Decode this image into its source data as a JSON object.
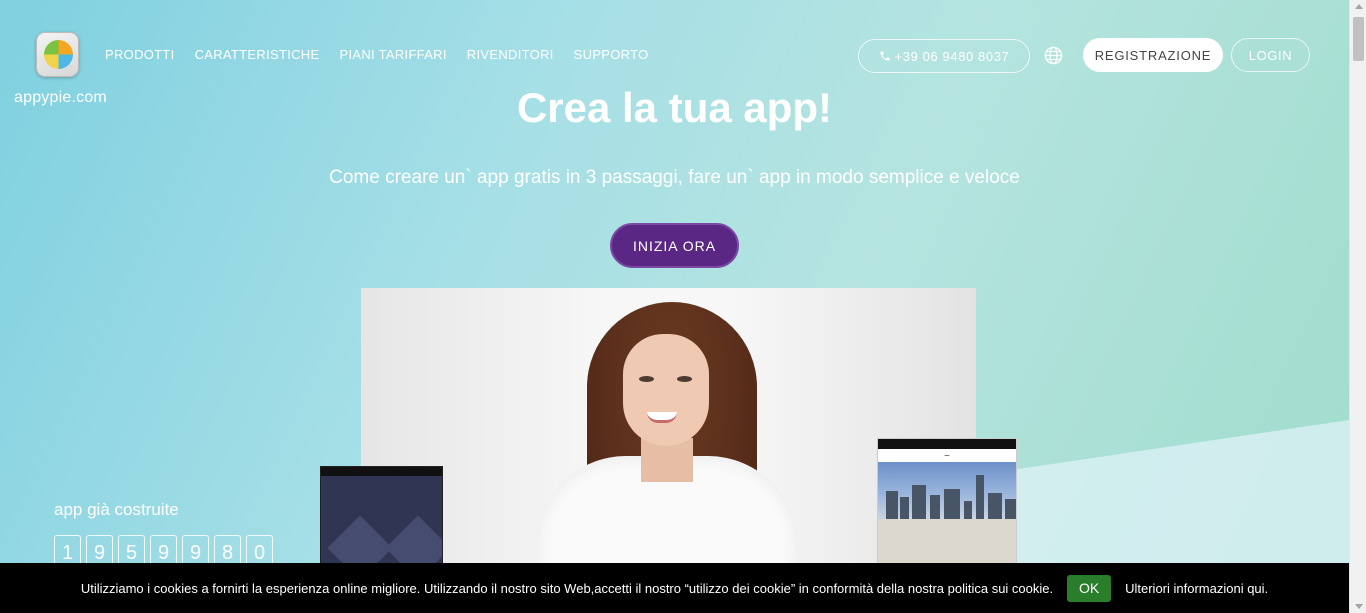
{
  "brand": {
    "logo_text": "appypie.com"
  },
  "nav": {
    "items": [
      "PRODOTTI",
      "CARATTERISTICHE",
      "PIANI TARIFFARI",
      "RIVENDITORI",
      "SUPPORTO"
    ]
  },
  "header": {
    "phone": "+39 06 9480 8037",
    "register_label": "REGISTRAZIONE",
    "login_label": "LOGIN"
  },
  "hero": {
    "title": "Crea la tua app!",
    "subtitle": "Come creare un` app gratis in 3 passaggi, fare un` app in modo semplice e veloce",
    "cta_label": "INIZIA ORA"
  },
  "counter": {
    "label": "app già costruite",
    "digits": [
      "1",
      "9",
      "5",
      "9",
      "9",
      "8",
      "0"
    ]
  },
  "cookie": {
    "text": "Utilizziamo i cookies a fornirti la esperienza online migliore. Utilizzando il nostro sito Web,accetti il nostro “utilizzo dei cookie” in conformità della nostra politica sui cookie.",
    "ok_label": "OK",
    "more_label": "Ulteriori informazioni qui."
  },
  "colors": {
    "cta": "#5b2785",
    "cookie_ok": "#2a7d2a"
  }
}
